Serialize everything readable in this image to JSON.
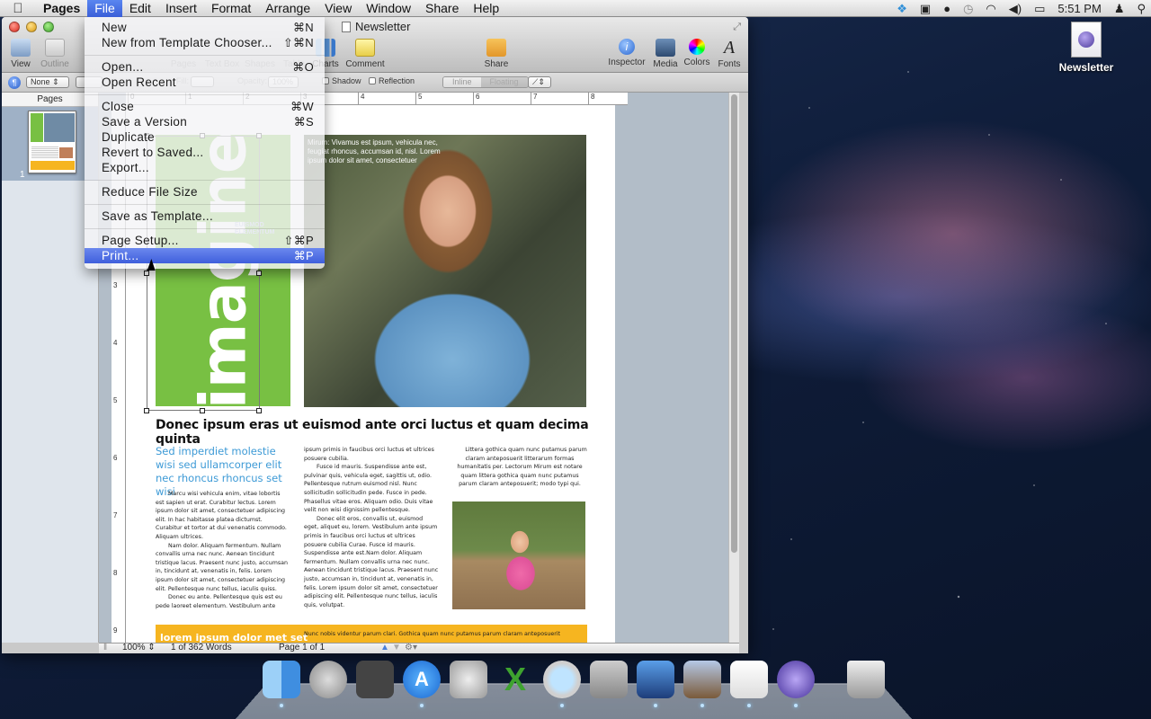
{
  "menubar": {
    "app_name": "Pages",
    "menus": [
      "File",
      "Edit",
      "Insert",
      "Format",
      "Arrange",
      "View",
      "Window",
      "Share",
      "Help"
    ],
    "active_menu": "File",
    "status_icons": [
      "dropbox-icon",
      "facetime-camera-icon",
      "alien-icon",
      "time-machine-icon",
      "wifi-icon",
      "volume-icon",
      "battery-icon"
    ],
    "clock": "5:51 PM"
  },
  "window": {
    "title": "Newsletter",
    "toolbar": {
      "view": "View",
      "outline": "Outline",
      "pages": "Pages",
      "text_box": "Text Box",
      "shapes": "Shapes",
      "table": "Table",
      "charts": "Charts",
      "comment": "Comment",
      "share": "Share",
      "inspector": "Inspector",
      "media": "Media",
      "colors": "Colors",
      "fonts": "Fonts"
    },
    "format_bar": {
      "style_select": "None",
      "fill_label": "Fill:",
      "opacity_label": "Opacity:",
      "opacity_value": "100%",
      "shadow_label": "Shadow",
      "reflection_label": "Reflection",
      "wrap_inline": "Inline",
      "wrap_floating": "Floating"
    },
    "sidebar": {
      "header": "Pages",
      "page_number": "1"
    },
    "ruler": {
      "h_marks": [
        "0",
        "1",
        "2",
        "3",
        "4",
        "5",
        "6",
        "7",
        "8"
      ],
      "v_marks": [
        "3",
        "4",
        "5",
        "6",
        "7",
        "8",
        "9"
      ]
    },
    "statusbar": {
      "zoom": "100%",
      "word_count": "1 of 362 Words",
      "page": "Page 1 of 1"
    }
  },
  "file_menu": {
    "items": [
      {
        "label": "New",
        "shortcut": "⌘N"
      },
      {
        "label": "New from Template Chooser...",
        "shortcut": "⇧⌘N"
      },
      {
        "sep": true
      },
      {
        "label": "Open...",
        "shortcut": "⌘O"
      },
      {
        "label": "Open Recent",
        "shortcut": ""
      },
      {
        "sep": true
      },
      {
        "label": "Close",
        "shortcut": "⌘W"
      },
      {
        "label": "Save a Version",
        "shortcut": "⌘S"
      },
      {
        "label": "Duplicate",
        "shortcut": ""
      },
      {
        "label": "Revert to Saved...",
        "shortcut": ""
      },
      {
        "label": "Export...",
        "shortcut": ""
      },
      {
        "sep": true
      },
      {
        "label": "Reduce File Size",
        "shortcut": ""
      },
      {
        "sep": true
      },
      {
        "label": "Save as Template...",
        "shortcut": ""
      },
      {
        "sep": true
      },
      {
        "label": "Page Setup...",
        "shortcut": "⇧⌘P"
      },
      {
        "label": "Print...",
        "shortcut": "⌘P",
        "highlighted": true
      }
    ]
  },
  "document": {
    "masthead": "imagine",
    "masthead_sub": [
      "EUISMOD",
      "ELEMENTUM"
    ],
    "photo_caption": "Mirum: Vivamus est ipsum, vehicula nec, feugiat rhoncus, accumsan id, nisl. Lorem ipsum dolor sit amet, consectetuer",
    "headline": "Donec ipsum eras ut euismod ante orci luctus et quam decima quinta",
    "subhead": "Sed imperdiet molestie wisi sed ullamcorper elit nec rhoncus rhoncus set wisi",
    "col1": [
      "Marcu wisi vehicula enim, vitae lobortis est sapien ut erat. Curabitur lectus. Lorem ipsum dolor sit amet, consectetuer adipiscing elit. In hac habitasse platea dictumst. Curabitur et tortor at dui venenatis commodo. Aliquam ultrices.",
      "Nam dolor. Aliquam fermentum. Nullam convallis urna nec nunc. Aenean tincidunt tristique lacus. Praesent nunc justo, accumsan in, tincidunt at, venenatis in, felis. Lorem ipsum dolor sit amet, consectetuer adipiscing elit. Pellentesque nunc tellus, iaculis quiss.",
      "Donec eu ante. Pellentesque quis est eu pede laoreet elementum. Vestibulum ante"
    ],
    "col2_lead": "ipsum primis in faucibus orci luctus et ultrices posuere cubilia.",
    "col2": [
      "Fusce id mauris. Suspendisse ante est, pulvinar quis, vehicula eget, sagittis ut, odio. Pellentesque rutrum euismod nisl. Nunc sollicitudin sollicitudin pede. Fusce in pede. Phasellus vitae eros. Aliquam odio. Duis vitae velit non wisi dignissim pellentesque.",
      "Donec elit eros, convallis ut, euismod eget, aliquet eu, lorem. Vestibulum ante ipsum primis in faucibus orci luctus et ultrices posuere cubilia Curae. Fusce id mauris. Suspendisse ante est.Nam dolor. Aliquam fermentum. Nullam convallis urna nec nunc. Aenean tincidunt tristique lacus. Praesent nunc justo, accumsan in, tincidunt at, venenatis in, felis. Lorem ipsum dolor sit amet, consectetuer adipiscing elit. Pellentesque nunc tellus, iaculis quis, volutpat."
    ],
    "col3": "Littera gothica quam nunc putamus parum claram anteposuerit litterarum formas humanitatis per. Lectorum Mirum est notare quam littera gothica quam nunc putamus parum claram anteposuerit; modo typi qui.",
    "footer_title": "lorem ipsum dolor met set",
    "footer_text": "Nunc nobis videntur parum clari. Gothica quam nunc putamus parum claram anteposuerit"
  },
  "desktop": {
    "icon_label": "Newsletter"
  },
  "dock": {
    "apps": [
      "finder",
      "launchpad",
      "photo-booth",
      "app-store",
      "automator",
      "excel",
      "safari",
      "facetime",
      "imovie",
      "mail",
      "textedit",
      "pages",
      "trash"
    ]
  }
}
